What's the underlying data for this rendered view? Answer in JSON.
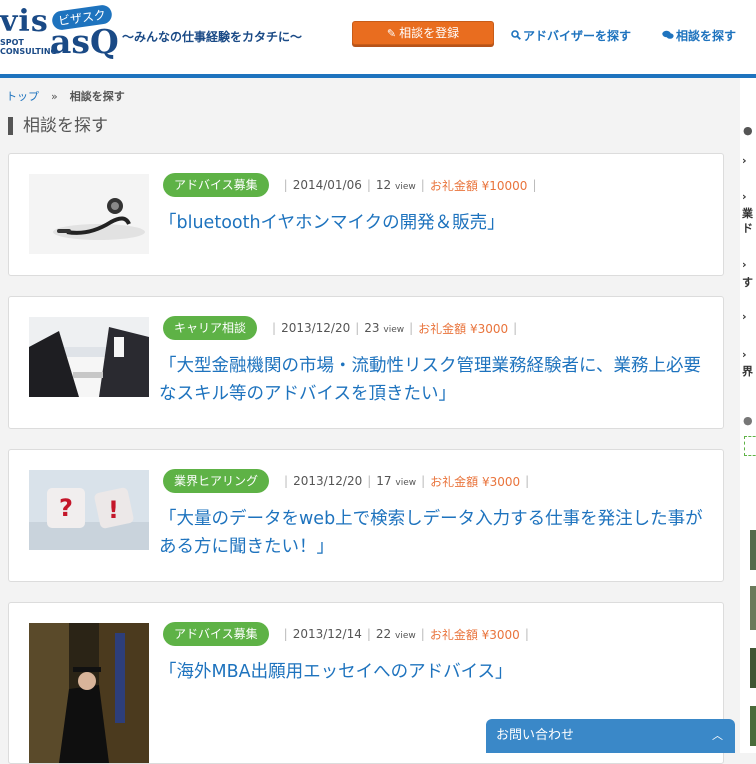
{
  "header": {
    "logo_vis": "vis",
    "logo_asq": "asQ",
    "logo_kana": "ビザスク",
    "logo_spot": "SPOT",
    "logo_consulting": "CONSULTING",
    "tagline": "〜みんなの仕事経験をカタチに〜",
    "register_label": "相談を登録",
    "find_advisor_label": "アドバイザーを探す",
    "find_consult_label": "相談を探す"
  },
  "breadcrumb": {
    "home": "トップ",
    "separator": "»",
    "current": "相談を探す"
  },
  "page_title": "相談を探す",
  "cards": [
    {
      "category": "アドバイス募集",
      "date": "2014/01/06",
      "views": "12",
      "view_unit": "view",
      "reward": "お礼金額 ¥10000",
      "title": "「bluetoothイヤホンマイクの開発＆販売」",
      "image": "earphone-photo"
    },
    {
      "category": "キャリア相談",
      "date": "2013/12/20",
      "views": "23",
      "view_unit": "view",
      "reward": "お礼金額 ¥3000",
      "title": "「大型金融機関の市場・流動性リスク管理業務経験者に、業務上必要なスキル等のアドバイスを頂きたい」",
      "image": "business-meeting-photo"
    },
    {
      "category": "業界ヒアリング",
      "date": "2013/12/20",
      "views": "17",
      "view_unit": "view",
      "reward": "お礼金額 ¥3000",
      "title": "「大量のデータをweb上で検索しデータ入力する仕事を発注した事がある方に聞きたい！」",
      "image": "question-dice-photo"
    },
    {
      "category": "アドバイス募集",
      "date": "2013/12/14",
      "views": "22",
      "view_unit": "view",
      "reward": "お礼金額 ¥3000",
      "title": "「海外MBA出願用エッセイへのアドバイス」",
      "image": "graduation-photo"
    }
  ],
  "right_panel": {
    "items": [
      "業",
      "ド",
      "す",
      "界"
    ]
  },
  "contact": {
    "label": "お問い合わせ",
    "icon": "chevron-up-icon"
  },
  "colors": {
    "brand": "#1e73be",
    "orange": "#e96d1f",
    "green": "#5eb246",
    "reward": "#e9743c"
  }
}
